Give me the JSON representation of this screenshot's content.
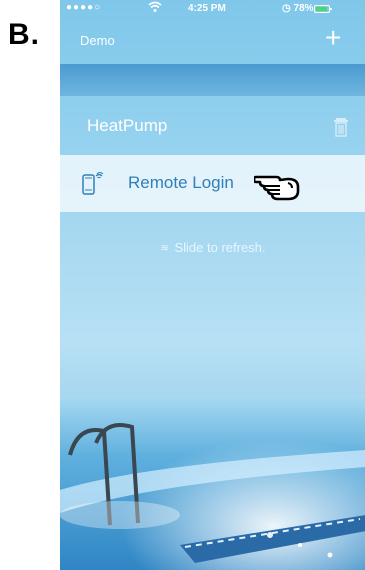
{
  "figure_label": "B.",
  "status_bar": {
    "carrier": "●●●●○",
    "time": "4:25 PM",
    "battery": "78%",
    "battery_level": 0.78,
    "icons": [
      "wifi-icon",
      "alarm-icon",
      "battery-icon"
    ]
  },
  "navbar": {
    "title": "Demo",
    "add_label": "+"
  },
  "devices": [
    {
      "name": "HeatPump",
      "icon": "trash-icon"
    }
  ],
  "remote_login": {
    "label": "Remote Login",
    "icon": "remote-phone-icon",
    "pointer_icon": "pointing-hand-icon"
  },
  "refresh": {
    "chevron": "≋",
    "text": "Slide to refresh."
  },
  "colors": {
    "accent": "#2f7fb8",
    "band": "#4b9ad0",
    "sky": "#8ecfee",
    "text_light": "#ffffff"
  }
}
